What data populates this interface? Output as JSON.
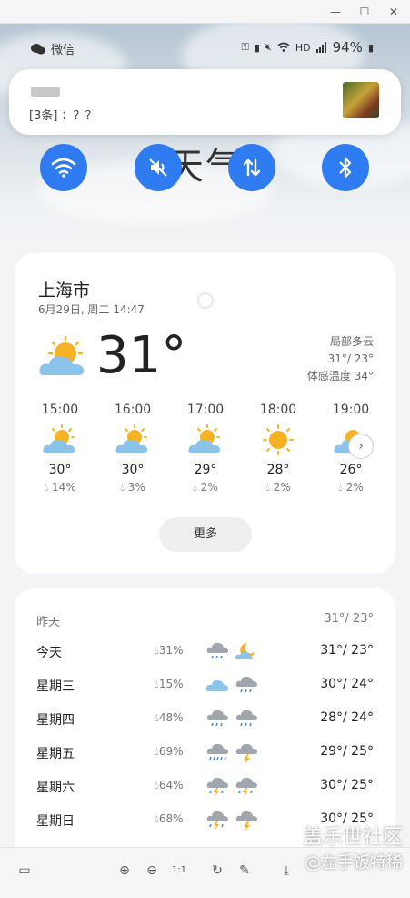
{
  "window": {
    "minimize": "—",
    "maximize": "☐",
    "close": "✕"
  },
  "status_bar": {
    "app": "微信",
    "hd": "HD",
    "battery": "94%"
  },
  "notification": {
    "message": "[3条]  ：？？"
  },
  "sky_title": "天气",
  "quick_buttons": [
    "wifi-icon",
    "mute-icon",
    "data-transfer-icon",
    "bluetooth-icon"
  ],
  "current": {
    "city": "上海市",
    "datetime": "6月29日, 周二 14:47",
    "temp": "31°",
    "condition": "局部多云",
    "hi_lo": "31°/ 23°",
    "feels_like": "体感温度 34°"
  },
  "hourly": [
    {
      "time": "15:00",
      "temp": "30°",
      "precip": "14%",
      "icon": "partly-sunny"
    },
    {
      "time": "16:00",
      "temp": "30°",
      "precip": "3%",
      "icon": "partly-sunny"
    },
    {
      "time": "17:00",
      "temp": "29°",
      "precip": "2%",
      "icon": "partly-sunny"
    },
    {
      "time": "18:00",
      "temp": "28°",
      "precip": "2%",
      "icon": "sunny"
    },
    {
      "time": "19:00",
      "temp": "26°",
      "precip": "2%",
      "icon": "partly-sunny"
    }
  ],
  "more_label": "更多",
  "yesterday": {
    "label": "昨天",
    "temps": "31°/ 23°"
  },
  "daily": [
    {
      "name": "今天",
      "precip": "31%",
      "temps": "31°/ 23°",
      "icon1": "rain",
      "icon2": "moon-cloud"
    },
    {
      "name": "星期三",
      "precip": "15%",
      "temps": "30°/ 24°",
      "icon1": "cloud-blue",
      "icon2": "rain"
    },
    {
      "name": "星期四",
      "precip": "48%",
      "temps": "28°/ 24°",
      "icon1": "rain",
      "icon2": "rain"
    },
    {
      "name": "星期五",
      "precip": "69%",
      "temps": "29°/ 25°",
      "icon1": "heavy-rain",
      "icon2": "thunder"
    },
    {
      "name": "星期六",
      "precip": "64%",
      "temps": "30°/ 25°",
      "icon1": "thunder-rain",
      "icon2": "thunder-rain"
    },
    {
      "name": "星期日",
      "precip": "68%",
      "temps": "30°/ 25°",
      "icon1": "thunder-rain",
      "icon2": "thunder"
    }
  ],
  "watermark": {
    "line1": "盖乐世社区",
    "line2": "@左手饭特稀"
  },
  "colors": {
    "accent": "#2f7cf2",
    "sun": "#f5b323",
    "cloud": "#8cc3ea",
    "rain_cloud": "#a0a6ad"
  }
}
